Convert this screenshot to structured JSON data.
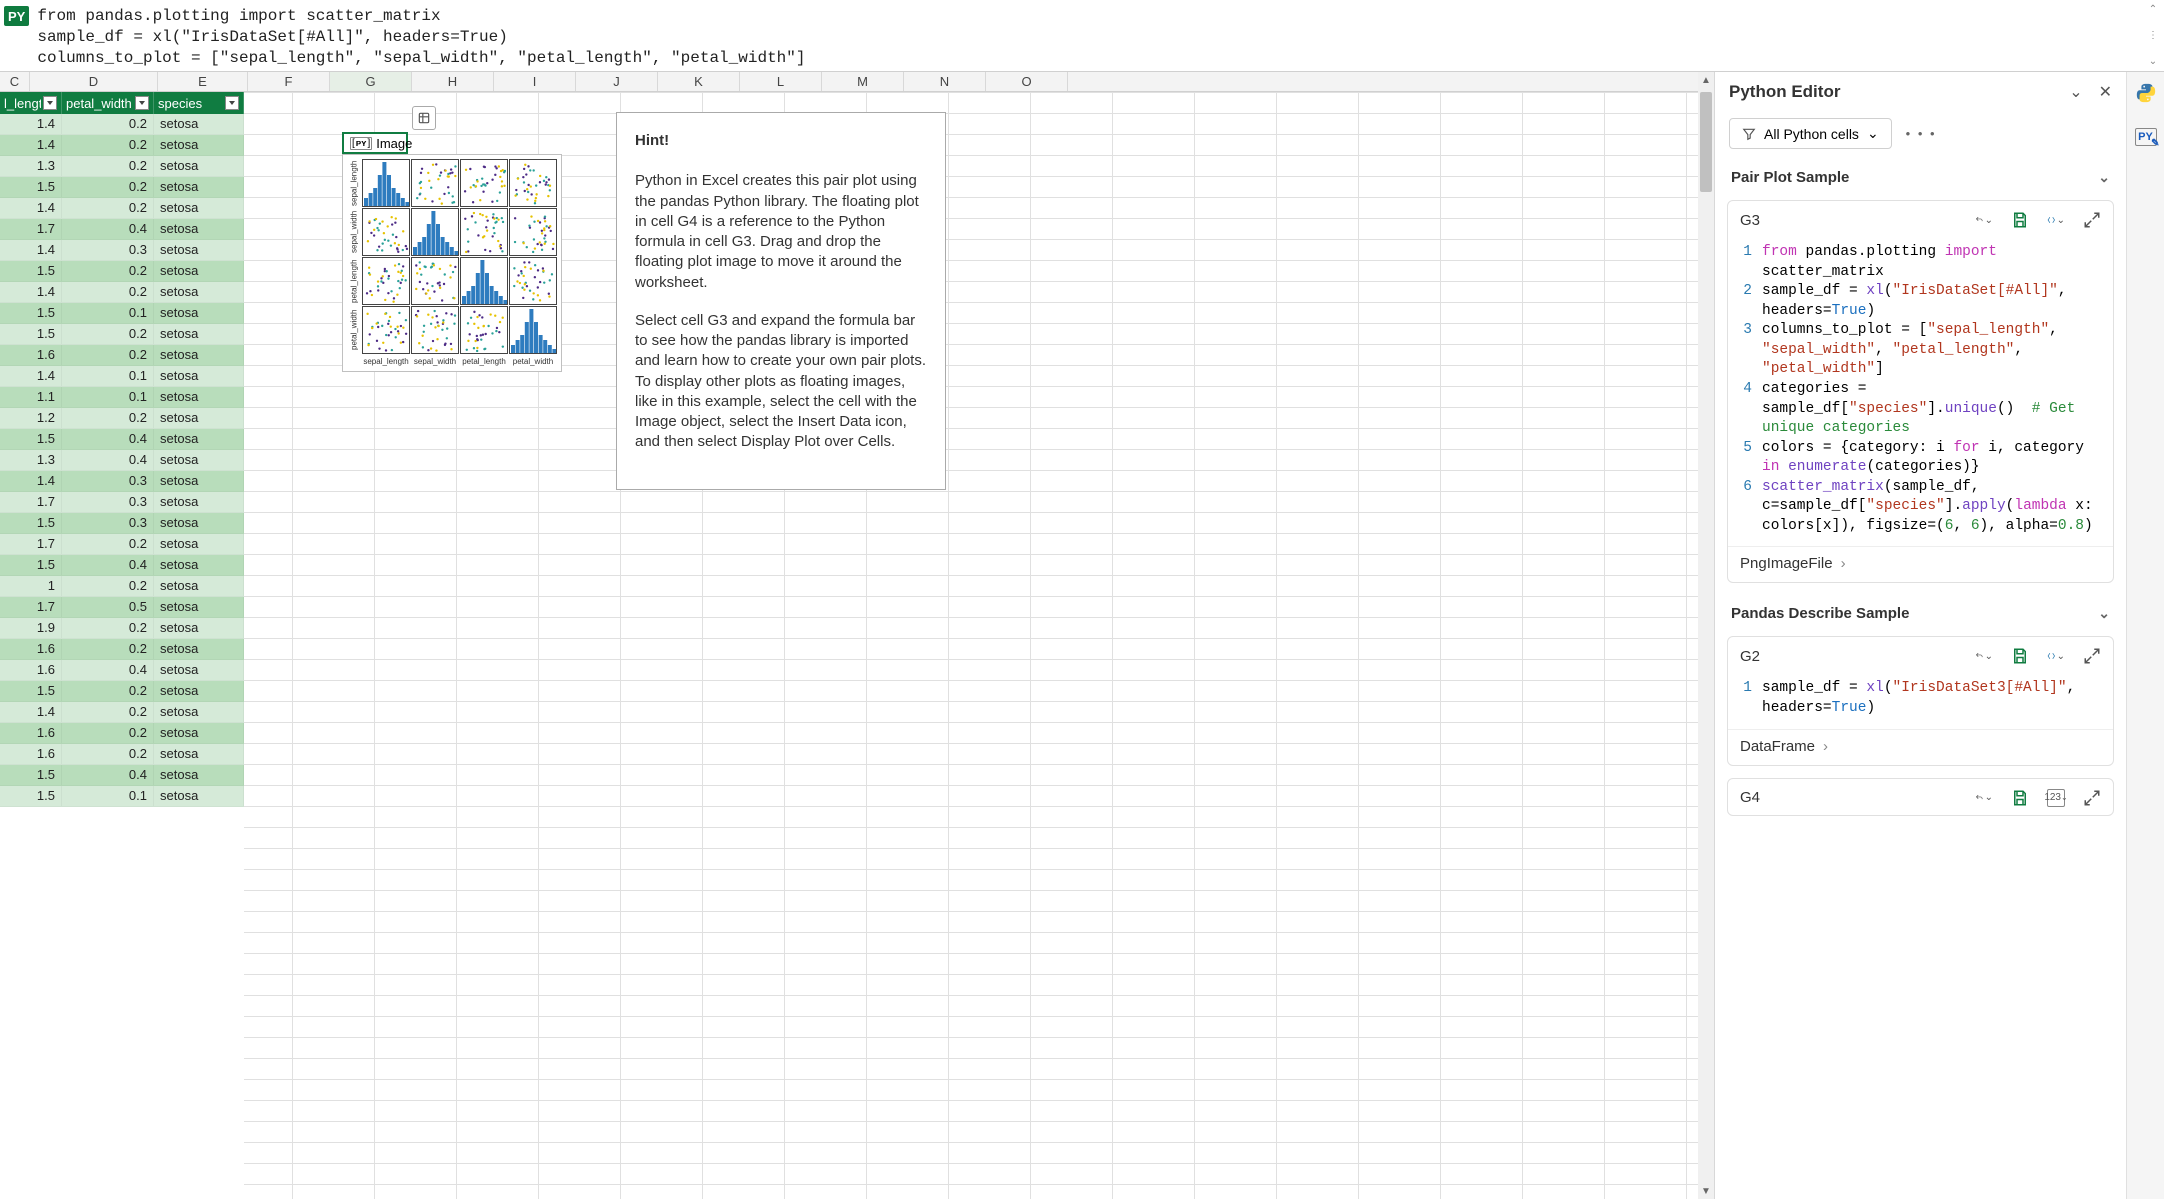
{
  "formula_bar": {
    "badge": "PY",
    "text": "from pandas.plotting import scatter_matrix\nsample_df = xl(\"IrisDataSet[#All]\", headers=True)\ncolumns_to_plot = [\"sepal_length\", \"sepal_width\", \"petal_length\", \"petal_width\"]"
  },
  "columns": [
    "C",
    "D",
    "E",
    "F",
    "G",
    "H",
    "I",
    "J",
    "K",
    "L",
    "M",
    "N",
    "O"
  ],
  "selected_column": "G",
  "column_widths": {
    "C_vis": 30,
    "D": 128,
    "E": 90,
    "other": 82
  },
  "table": {
    "headers": [
      "l_length",
      "petal_width",
      "species"
    ],
    "rows": [
      [
        1.4,
        0.2,
        "setosa"
      ],
      [
        1.4,
        0.2,
        "setosa"
      ],
      [
        1.3,
        0.2,
        "setosa"
      ],
      [
        1.5,
        0.2,
        "setosa"
      ],
      [
        1.4,
        0.2,
        "setosa"
      ],
      [
        1.7,
        0.4,
        "setosa"
      ],
      [
        1.4,
        0.3,
        "setosa"
      ],
      [
        1.5,
        0.2,
        "setosa"
      ],
      [
        1.4,
        0.2,
        "setosa"
      ],
      [
        1.5,
        0.1,
        "setosa"
      ],
      [
        1.5,
        0.2,
        "setosa"
      ],
      [
        1.6,
        0.2,
        "setosa"
      ],
      [
        1.4,
        0.1,
        "setosa"
      ],
      [
        1.1,
        0.1,
        "setosa"
      ],
      [
        1.2,
        0.2,
        "setosa"
      ],
      [
        1.5,
        0.4,
        "setosa"
      ],
      [
        1.3,
        0.4,
        "setosa"
      ],
      [
        1.4,
        0.3,
        "setosa"
      ],
      [
        1.7,
        0.3,
        "setosa"
      ],
      [
        1.5,
        0.3,
        "setosa"
      ],
      [
        1.7,
        0.2,
        "setosa"
      ],
      [
        1.5,
        0.4,
        "setosa"
      ],
      [
        1,
        0.2,
        "setosa"
      ],
      [
        1.7,
        0.5,
        "setosa"
      ],
      [
        1.9,
        0.2,
        "setosa"
      ],
      [
        1.6,
        0.2,
        "setosa"
      ],
      [
        1.6,
        0.4,
        "setosa"
      ],
      [
        1.5,
        0.2,
        "setosa"
      ],
      [
        1.4,
        0.2,
        "setosa"
      ],
      [
        1.6,
        0.2,
        "setosa"
      ],
      [
        1.6,
        0.2,
        "setosa"
      ],
      [
        1.5,
        0.4,
        "setosa"
      ],
      [
        1.5,
        0.1,
        "setosa"
      ]
    ]
  },
  "selected_cell": {
    "label": "Image",
    "ref": "G3"
  },
  "pairplot": {
    "axis_labels": [
      "sepal_length",
      "sepal_width",
      "petal_length",
      "petal_width"
    ]
  },
  "hint": {
    "title": "Hint!",
    "p1": "Python in Excel creates this pair plot using the pandas Python library. The floating plot in cell G4 is a reference to the Python formula in cell G3. Drag and drop the floating plot image to move it around the worksheet.",
    "p2": "Select cell G3 and expand the formula bar to see how the pandas library is imported and learn how to create your own pair plots. To display other plots as floating images, like in this example, select the cell with the Image object, select the Insert Data icon, and then select Display Plot over Cells."
  },
  "side_panel": {
    "title": "Python Editor",
    "filter_label": "All Python cells",
    "sections": [
      {
        "title": "Pair Plot Sample",
        "cell_ref": "G3",
        "footer": "PngImageFile",
        "code": [
          {
            "n": 1,
            "html": "<span class='kw'>from</span> pandas.plotting <span class='kw'>import</span> scatter_matrix"
          },
          {
            "n": 2,
            "html": "sample_df = <span class='fn'>xl</span>(<span class='str'>\"IrisDataSet[#All]\"</span>, headers=<span class='bool'>True</span>)"
          },
          {
            "n": 3,
            "html": "columns_to_plot = [<span class='str'>\"sepal_length\"</span>, <span class='str'>\"sepal_width\"</span>, <span class='str'>\"petal_length\"</span>, <span class='str'>\"petal_width\"</span>]"
          },
          {
            "n": 4,
            "html": "categories = sample_df[<span class='str'>\"species\"</span>].<span class='fn'>unique</span>()  <span class='cmt'># Get unique categories</span>"
          },
          {
            "n": 5,
            "html": "colors = {category: i <span class='kw'>for</span> i, category <span class='kw'>in</span> <span class='fn'>enumerate</span>(categories)}"
          },
          {
            "n": 6,
            "html": "<span class='fn'>scatter_matrix</span>(sample_df, c=sample_df[<span class='str'>\"species\"</span>].<span class='fn'>apply</span>(<span class='kw'>lambda</span> x: colors[x]), figsize=(<span class='num'>6</span>, <span class='num'>6</span>), alpha=<span class='num'>0.8</span>)"
          }
        ]
      },
      {
        "title": "Pandas Describe Sample",
        "cell_ref": "G2",
        "footer": "DataFrame",
        "code": [
          {
            "n": 1,
            "html": "sample_df = <span class='fn'>xl</span>(<span class='str'>\"IrisDataSet3[#All]\"</span>, headers=<span class='bool'>True</span>)"
          }
        ]
      },
      {
        "title": "",
        "cell_ref": "G4",
        "footer": "",
        "output_badge": "123",
        "code": []
      }
    ]
  }
}
